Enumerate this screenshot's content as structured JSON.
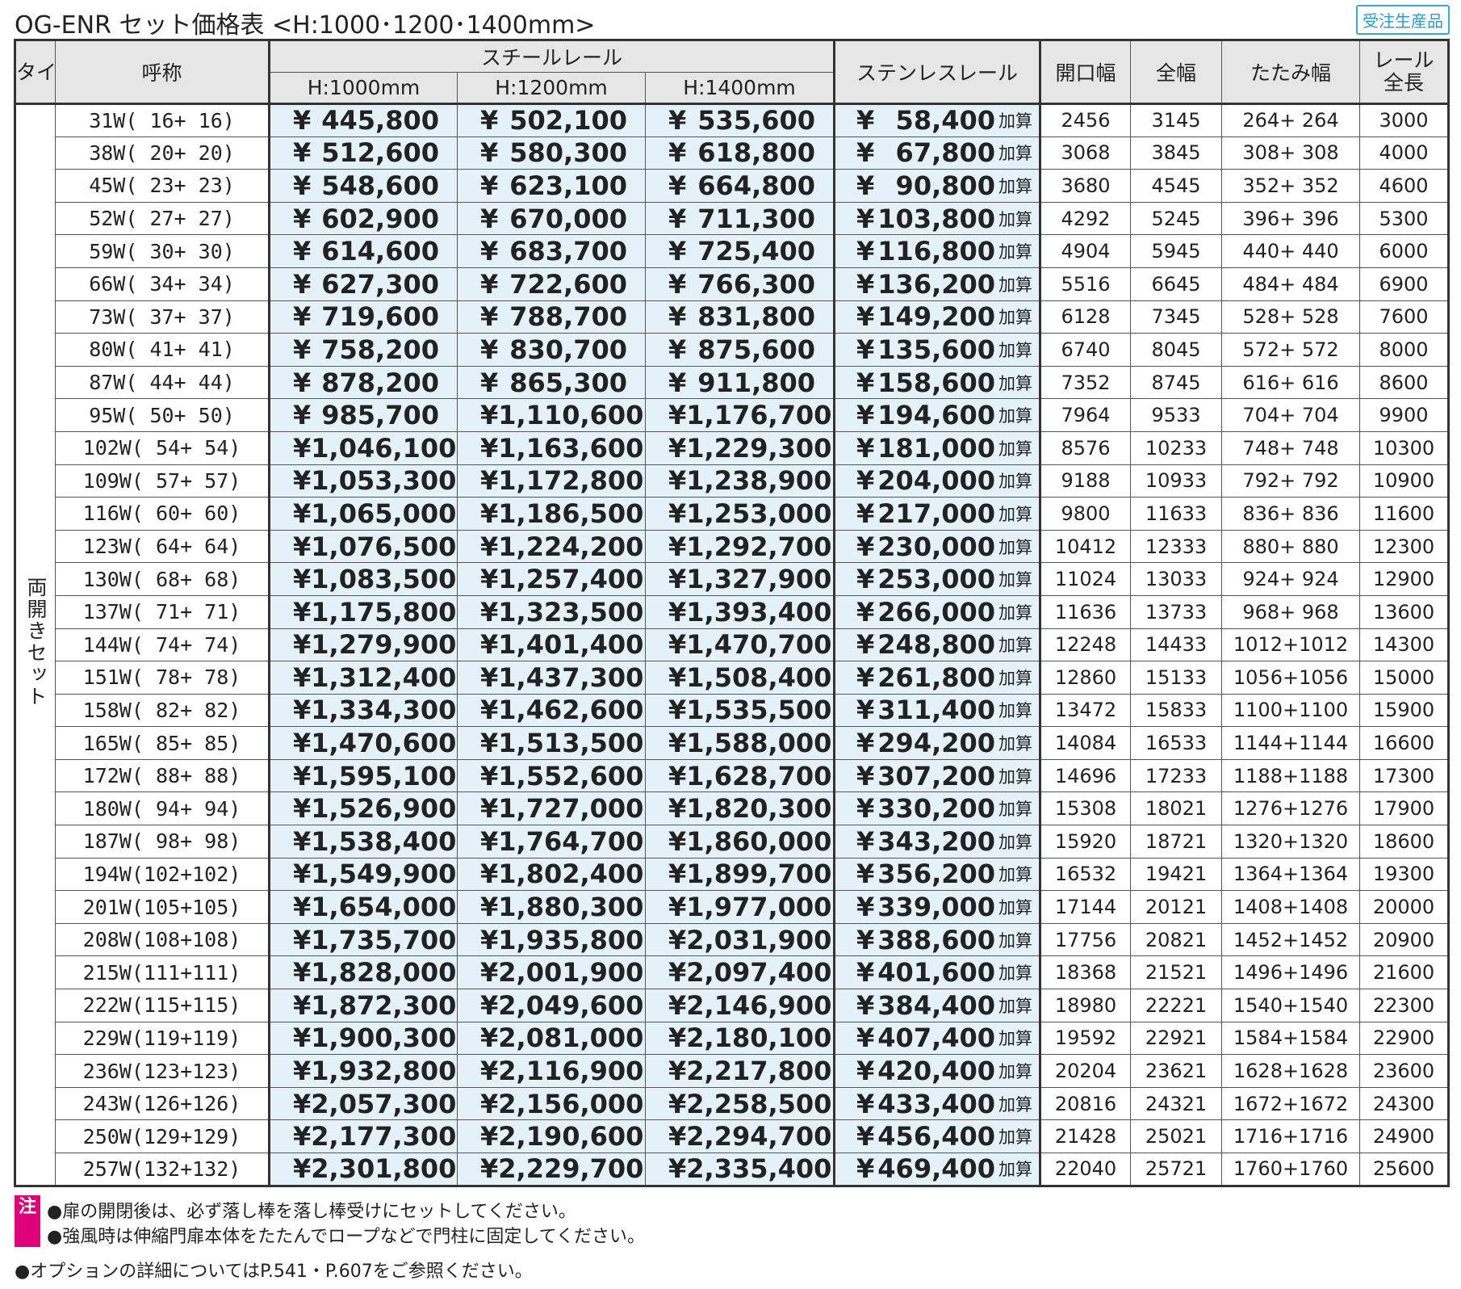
{
  "title": "OG-ENR セット価格表 <H:1000･1200･1400mm>",
  "badge": "受注生産品",
  "headers": {
    "type": "タイプ",
    "name": "呼称",
    "steel_rail": "スチールレール",
    "h1000": "H:1000mm",
    "h1200": "H:1200mm",
    "h1400": "H:1400mm",
    "stainless_rail": "ステンレスレール",
    "opening_width": "開口幅",
    "total_width": "全幅",
    "folded_width": "たたみ幅",
    "rail_length_l1": "レール",
    "rail_length_l2": "全長"
  },
  "type_label": "両開きセット",
  "currency": "¥",
  "add_label": "加算",
  "rows": [
    {
      "name": "31W(  16+  16)",
      "h1000": "445,800",
      "h1200": "502,100",
      "h1400": "535,600",
      "stainless": "58,400",
      "opening": "2456",
      "total": "3145",
      "folded": "264+  264",
      "rail": "3000"
    },
    {
      "name": "38W(  20+  20)",
      "h1000": "512,600",
      "h1200": "580,300",
      "h1400": "618,800",
      "stainless": "67,800",
      "opening": "3068",
      "total": "3845",
      "folded": "308+  308",
      "rail": "4000"
    },
    {
      "name": "45W(  23+  23)",
      "h1000": "548,600",
      "h1200": "623,100",
      "h1400": "664,800",
      "stainless": "90,800",
      "opening": "3680",
      "total": "4545",
      "folded": "352+  352",
      "rail": "4600"
    },
    {
      "name": "52W(  27+  27)",
      "h1000": "602,900",
      "h1200": "670,000",
      "h1400": "711,300",
      "stainless": "103,800",
      "opening": "4292",
      "total": "5245",
      "folded": "396+  396",
      "rail": "5300"
    },
    {
      "name": "59W(  30+  30)",
      "h1000": "614,600",
      "h1200": "683,700",
      "h1400": "725,400",
      "stainless": "116,800",
      "opening": "4904",
      "total": "5945",
      "folded": "440+  440",
      "rail": "6000"
    },
    {
      "name": "66W(  34+  34)",
      "h1000": "627,300",
      "h1200": "722,600",
      "h1400": "766,300",
      "stainless": "136,200",
      "opening": "5516",
      "total": "6645",
      "folded": "484+  484",
      "rail": "6900"
    },
    {
      "name": "73W(  37+  37)",
      "h1000": "719,600",
      "h1200": "788,700",
      "h1400": "831,800",
      "stainless": "149,200",
      "opening": "6128",
      "total": "7345",
      "folded": "528+  528",
      "rail": "7600"
    },
    {
      "name": "80W(  41+  41)",
      "h1000": "758,200",
      "h1200": "830,700",
      "h1400": "875,600",
      "stainless": "135,600",
      "opening": "6740",
      "total": "8045",
      "folded": "572+  572",
      "rail": "8000"
    },
    {
      "name": "87W(  44+  44)",
      "h1000": "878,200",
      "h1200": "865,300",
      "h1400": "911,800",
      "stainless": "158,600",
      "opening": "7352",
      "total": "8745",
      "folded": "616+  616",
      "rail": "8600"
    },
    {
      "name": "95W(  50+  50)",
      "h1000": "985,700",
      "h1200": "1,110,600",
      "h1400": "1,176,700",
      "stainless": "194,600",
      "opening": "7964",
      "total": "9533",
      "folded": "704+  704",
      "rail": "9900"
    },
    {
      "name": "102W(  54+  54)",
      "h1000": "1,046,100",
      "h1200": "1,163,600",
      "h1400": "1,229,300",
      "stainless": "181,000",
      "opening": "8576",
      "total": "10233",
      "folded": "748+  748",
      "rail": "10300"
    },
    {
      "name": "109W(  57+  57)",
      "h1000": "1,053,300",
      "h1200": "1,172,800",
      "h1400": "1,238,900",
      "stainless": "204,000",
      "opening": "9188",
      "total": "10933",
      "folded": "792+  792",
      "rail": "10900"
    },
    {
      "name": "116W(  60+  60)",
      "h1000": "1,065,000",
      "h1200": "1,186,500",
      "h1400": "1,253,000",
      "stainless": "217,000",
      "opening": "9800",
      "total": "11633",
      "folded": "836+  836",
      "rail": "11600"
    },
    {
      "name": "123W(  64+  64)",
      "h1000": "1,076,500",
      "h1200": "1,224,200",
      "h1400": "1,292,700",
      "stainless": "230,000",
      "opening": "10412",
      "total": "12333",
      "folded": "880+  880",
      "rail": "12300"
    },
    {
      "name": "130W(  68+  68)",
      "h1000": "1,083,500",
      "h1200": "1,257,400",
      "h1400": "1,327,900",
      "stainless": "253,000",
      "opening": "11024",
      "total": "13033",
      "folded": "924+  924",
      "rail": "12900"
    },
    {
      "name": "137W(  71+  71)",
      "h1000": "1,175,800",
      "h1200": "1,323,500",
      "h1400": "1,393,400",
      "stainless": "266,000",
      "opening": "11636",
      "total": "13733",
      "folded": "968+  968",
      "rail": "13600"
    },
    {
      "name": "144W(  74+  74)",
      "h1000": "1,279,900",
      "h1200": "1,401,400",
      "h1400": "1,470,700",
      "stainless": "248,800",
      "opening": "12248",
      "total": "14433",
      "folded": "1012+1012",
      "rail": "14300"
    },
    {
      "name": "151W(  78+  78)",
      "h1000": "1,312,400",
      "h1200": "1,437,300",
      "h1400": "1,508,400",
      "stainless": "261,800",
      "opening": "12860",
      "total": "15133",
      "folded": "1056+1056",
      "rail": "15000"
    },
    {
      "name": "158W(  82+  82)",
      "h1000": "1,334,300",
      "h1200": "1,462,600",
      "h1400": "1,535,500",
      "stainless": "311,400",
      "opening": "13472",
      "total": "15833",
      "folded": "1100+1100",
      "rail": "15900"
    },
    {
      "name": "165W(  85+  85)",
      "h1000": "1,470,600",
      "h1200": "1,513,500",
      "h1400": "1,588,000",
      "stainless": "294,200",
      "opening": "14084",
      "total": "16533",
      "folded": "1144+1144",
      "rail": "16600"
    },
    {
      "name": "172W(  88+  88)",
      "h1000": "1,595,100",
      "h1200": "1,552,600",
      "h1400": "1,628,700",
      "stainless": "307,200",
      "opening": "14696",
      "total": "17233",
      "folded": "1188+1188",
      "rail": "17300"
    },
    {
      "name": "180W(  94+  94)",
      "h1000": "1,526,900",
      "h1200": "1,727,000",
      "h1400": "1,820,300",
      "stainless": "330,200",
      "opening": "15308",
      "total": "18021",
      "folded": "1276+1276",
      "rail": "17900"
    },
    {
      "name": "187W(  98+  98)",
      "h1000": "1,538,400",
      "h1200": "1,764,700",
      "h1400": "1,860,000",
      "stainless": "343,200",
      "opening": "15920",
      "total": "18721",
      "folded": "1320+1320",
      "rail": "18600"
    },
    {
      "name": "194W(102+102)",
      "h1000": "1,549,900",
      "h1200": "1,802,400",
      "h1400": "1,899,700",
      "stainless": "356,200",
      "opening": "16532",
      "total": "19421",
      "folded": "1364+1364",
      "rail": "19300"
    },
    {
      "name": "201W(105+105)",
      "h1000": "1,654,000",
      "h1200": "1,880,300",
      "h1400": "1,977,000",
      "stainless": "339,000",
      "opening": "17144",
      "total": "20121",
      "folded": "1408+1408",
      "rail": "20000"
    },
    {
      "name": "208W(108+108)",
      "h1000": "1,735,700",
      "h1200": "1,935,800",
      "h1400": "2,031,900",
      "stainless": "388,600",
      "opening": "17756",
      "total": "20821",
      "folded": "1452+1452",
      "rail": "20900"
    },
    {
      "name": "215W(111+111)",
      "h1000": "1,828,000",
      "h1200": "2,001,900",
      "h1400": "2,097,400",
      "stainless": "401,600",
      "opening": "18368",
      "total": "21521",
      "folded": "1496+1496",
      "rail": "21600"
    },
    {
      "name": "222W(115+115)",
      "h1000": "1,872,300",
      "h1200": "2,049,600",
      "h1400": "2,146,900",
      "stainless": "384,400",
      "opening": "18980",
      "total": "22221",
      "folded": "1540+1540",
      "rail": "22300"
    },
    {
      "name": "229W(119+119)",
      "h1000": "1,900,300",
      "h1200": "2,081,000",
      "h1400": "2,180,100",
      "stainless": "407,400",
      "opening": "19592",
      "total": "22921",
      "folded": "1584+1584",
      "rail": "22900"
    },
    {
      "name": "236W(123+123)",
      "h1000": "1,932,800",
      "h1200": "2,116,900",
      "h1400": "2,217,800",
      "stainless": "420,400",
      "opening": "20204",
      "total": "23621",
      "folded": "1628+1628",
      "rail": "23600"
    },
    {
      "name": "243W(126+126)",
      "h1000": "2,057,300",
      "h1200": "2,156,000",
      "h1400": "2,258,500",
      "stainless": "433,400",
      "opening": "20816",
      "total": "24321",
      "folded": "1672+1672",
      "rail": "24300"
    },
    {
      "name": "250W(129+129)",
      "h1000": "2,177,300",
      "h1200": "2,190,600",
      "h1400": "2,294,700",
      "stainless": "456,400",
      "opening": "21428",
      "total": "25021",
      "folded": "1716+1716",
      "rail": "24900"
    },
    {
      "name": "257W(132+132)",
      "h1000": "2,301,800",
      "h1200": "2,229,700",
      "h1400": "2,335,400",
      "stainless": "469,400",
      "opening": "22040",
      "total": "25721",
      "folded": "1760+1760",
      "rail": "25600"
    }
  ],
  "notes": {
    "mark": "注",
    "line1": "●扉の開閉後は、必ず落し棒を落し棒受けにセットしてください。",
    "line2": "●強風時は伸縮門扉本体をたたんでロープなどで門柱に固定してください。",
    "line3": "●オプションの詳細についてはP.541・P.607をご参照ください。"
  }
}
